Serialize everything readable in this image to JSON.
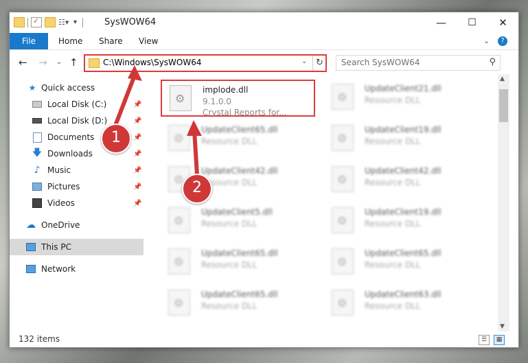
{
  "window": {
    "title": "SysWOW64",
    "minimize": "—",
    "maximize": "☐",
    "close": "✕"
  },
  "ribbon": {
    "tabs": [
      "File",
      "Home",
      "Share",
      "View"
    ],
    "help_icon": "?",
    "collapse_icon": "⌄"
  },
  "nav": {
    "back": "←",
    "forward": "→",
    "recent": "⌄",
    "up": "↑",
    "address": "C:\\Windows\\SysWOW64",
    "search_placeholder": "Search SysWOW64"
  },
  "sidebar": {
    "items": [
      {
        "label": "Quick access",
        "icon": "star-icon",
        "pinned": false
      },
      {
        "label": "Local Disk (C:)",
        "icon": "drive-icon",
        "pinned": true
      },
      {
        "label": "Local Disk (D:)",
        "icon": "drive-icon",
        "pinned": true
      },
      {
        "label": "Documents",
        "icon": "documents-icon",
        "pinned": true
      },
      {
        "label": "Downloads",
        "icon": "download-icon",
        "pinned": true
      },
      {
        "label": "Music",
        "icon": "music-icon",
        "pinned": true
      },
      {
        "label": "Pictures",
        "icon": "pictures-icon",
        "pinned": true
      },
      {
        "label": "Videos",
        "icon": "video-icon",
        "pinned": true
      },
      {
        "label": "OneDrive",
        "icon": "cloud-icon",
        "pinned": false
      },
      {
        "label": "This PC",
        "icon": "computer-icon",
        "pinned": false,
        "selected": true
      },
      {
        "label": "Network",
        "icon": "network-icon",
        "pinned": false
      }
    ]
  },
  "files": [
    {
      "name": "implode.dll",
      "line2": "9.1.0.0",
      "line3": "Crystal Reports for...",
      "highlighted": true
    },
    {
      "name": "UpdateClient21.dll",
      "line2": "Resource DLL",
      "line3": ""
    },
    {
      "name": "UpdateClient65.dll",
      "line2": "Resource DLL",
      "line3": ""
    },
    {
      "name": "UpdateClient19.dll",
      "line2": "Resource DLL",
      "line3": ""
    },
    {
      "name": "UpdateClient42.dll",
      "line2": "Resource DLL",
      "line3": ""
    },
    {
      "name": "UpdateClient42.dll",
      "line2": "Resource DLL",
      "line3": ""
    },
    {
      "name": "UpdateClient5.dll",
      "line2": "Resource DLL",
      "line3": ""
    },
    {
      "name": "UpdateClient19.dll",
      "line2": "Resource DLL",
      "line3": ""
    },
    {
      "name": "UpdateClient65.dll",
      "line2": "Resource DLL",
      "line3": ""
    },
    {
      "name": "UpdateClient65.dll",
      "line2": "Resource DLL",
      "line3": ""
    },
    {
      "name": "UpdateClient65.dll",
      "line2": "Resource DLL",
      "line3": ""
    },
    {
      "name": "UpdateClient63.dll",
      "line2": "Resource DLL",
      "line3": ""
    }
  ],
  "status": {
    "item_count": "132 items"
  },
  "callouts": [
    "1",
    "2"
  ],
  "colors": {
    "accent": "#1979ca",
    "highlight": "#e03a3a"
  }
}
